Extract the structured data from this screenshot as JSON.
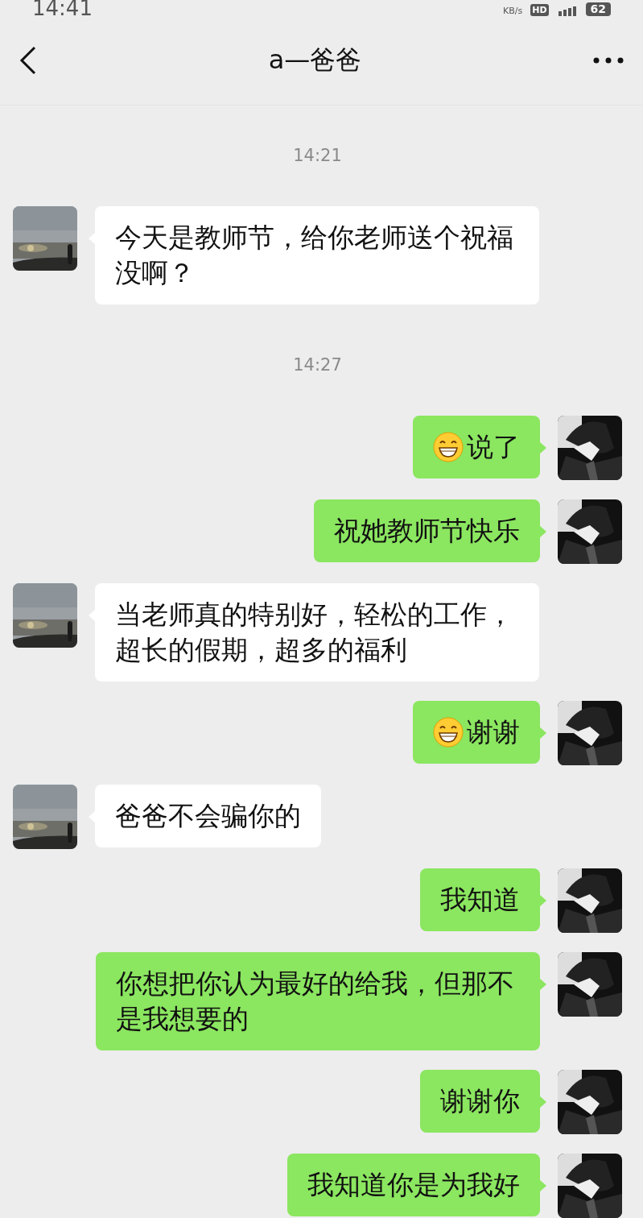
{
  "status_bar": {
    "time": "14:41",
    "speed": "KB/s",
    "network": "HD",
    "battery": "62"
  },
  "header": {
    "title": "a—爸爸"
  },
  "items": [
    {
      "kind": "time",
      "text": "14:21"
    },
    {
      "kind": "received",
      "emoji": false,
      "text": "今天是教师节，给你老师送个祝福没啊？"
    },
    {
      "kind": "time",
      "text": "14:27"
    },
    {
      "kind": "sent",
      "emoji": true,
      "text": "说了"
    },
    {
      "kind": "sent",
      "emoji": false,
      "text": "祝她教师节快乐"
    },
    {
      "kind": "received",
      "emoji": false,
      "text": "当老师真的特别好，轻松的工作，超长的假期，超多的福利"
    },
    {
      "kind": "sent",
      "emoji": true,
      "text": "谢谢"
    },
    {
      "kind": "received",
      "emoji": false,
      "text": "爸爸不会骗你的"
    },
    {
      "kind": "sent",
      "emoji": false,
      "text": "我知道"
    },
    {
      "kind": "sent",
      "emoji": false,
      "text": "你想把你认为最好的给我，但那不是我想要的"
    },
    {
      "kind": "sent",
      "emoji": false,
      "text": "谢谢你"
    },
    {
      "kind": "sent",
      "emoji": false,
      "text": "我知道你是为我好"
    }
  ]
}
